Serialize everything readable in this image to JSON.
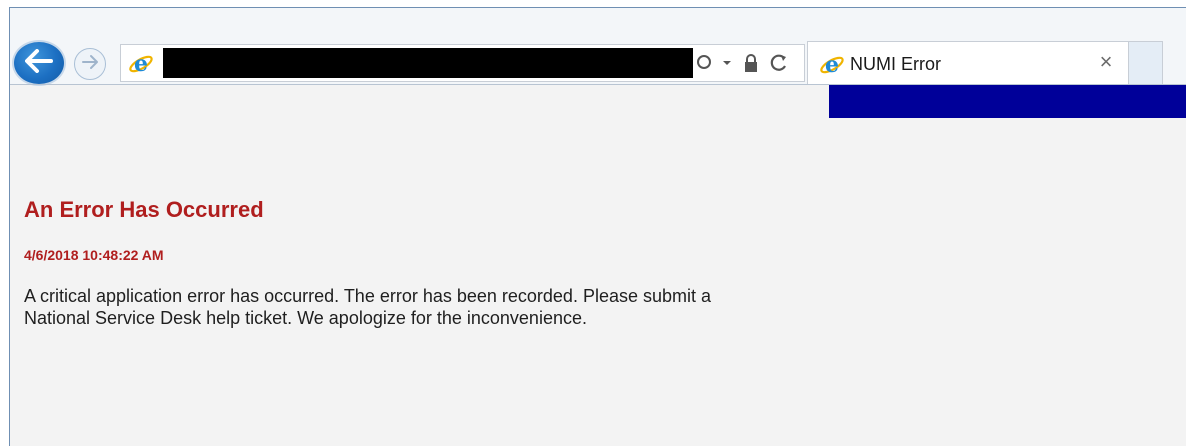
{
  "browser": {
    "tab": {
      "title": "NUMI Error",
      "close_label": "×"
    },
    "address_bar": {
      "url": ""
    },
    "icons": {
      "back": "back-arrow-icon",
      "forward": "forward-arrow-icon",
      "site": "internet-explorer-icon",
      "search": "search-icon",
      "dropdown": "dropdown-arrow-icon",
      "lock": "lock-icon",
      "refresh": "refresh-icon"
    },
    "colors": {
      "back_button": "#1c6fc2",
      "page_banner": "#000099",
      "error_text": "#b01e1e"
    }
  },
  "page": {
    "title": "An Error Has Occurred",
    "timestamp": "4/6/2018 10:48:22 AM",
    "message_line1": "A critical application error has occurred. The error has been recorded. Please submit a",
    "message_line2": "National Service Desk help ticket. We apologize for the inconvenience."
  }
}
